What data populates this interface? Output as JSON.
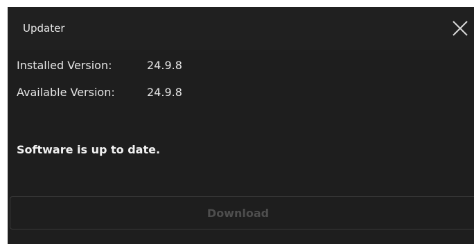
{
  "window": {
    "title": "Updater",
    "close_icon": "close-icon"
  },
  "versions": {
    "installed_label": "Installed Version:",
    "installed_value": "24.9.8",
    "available_label": "Available Version:",
    "available_value": "24.9.8"
  },
  "status": {
    "message": "Software is up to date."
  },
  "actions": {
    "download_label": "Download",
    "download_enabled": false
  },
  "colors": {
    "window_background": "#1e1e1e",
    "titlebar_background": "#202020",
    "text": "#e6e6e6",
    "disabled_text": "#4e4e4e",
    "button_border": "#3a3a3a"
  }
}
